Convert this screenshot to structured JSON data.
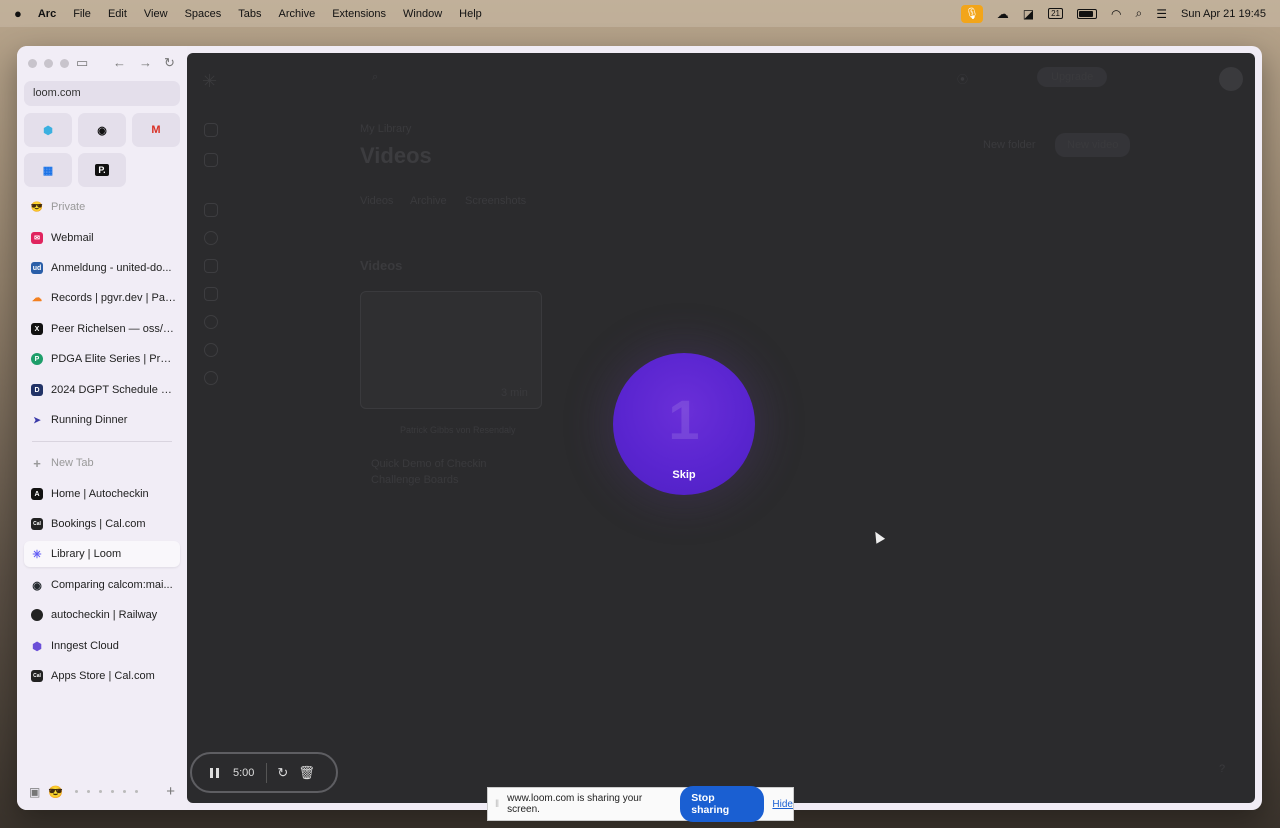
{
  "menubar": {
    "app": "Arc",
    "items": [
      "File",
      "Edit",
      "View",
      "Spaces",
      "Tabs",
      "Archive",
      "Extensions",
      "Window",
      "Help"
    ],
    "clock": "Sun Apr 21  19:45",
    "calendar_day": "21"
  },
  "sidebar": {
    "url": "loom.com",
    "pinned": [
      {
        "icon": "app-icon",
        "color": "#3bb0e0"
      },
      {
        "icon": "github-icon",
        "color": "#111111"
      },
      {
        "icon": "gmail-icon",
        "color": "#d93025"
      },
      {
        "icon": "calendar-icon",
        "color": "#1a73e8"
      },
      {
        "icon": "app-p-icon",
        "color": "#111111"
      }
    ],
    "tabs": [
      {
        "label": "Private",
        "icon_char": "😎",
        "color": "#f4c542",
        "muted": true
      },
      {
        "label": "Webmail",
        "icon_char": "✉",
        "color": "#e0245e"
      },
      {
        "label": "Anmeldung - united-do...",
        "icon_char": "ud",
        "color": "#2a5ea8"
      },
      {
        "label": "Records | pgvr.dev | Pat...",
        "icon_char": "☁",
        "color": "#f38020"
      },
      {
        "label": "Peer Richelsen — oss/a...",
        "icon_char": "X",
        "color": "#111111"
      },
      {
        "label": "PDGA Elite Series | Prof...",
        "icon_char": "P",
        "color": "#1e9e6a"
      },
      {
        "label": "2024 DGPT Schedule S...",
        "icon_char": "D",
        "color": "#223366"
      },
      {
        "label": "Running Dinner",
        "icon_char": "R",
        "color": "#3a3aa8"
      }
    ],
    "new_tab": "New Tab",
    "tabs2": [
      {
        "label": "Home | Autocheckin",
        "icon_char": "A",
        "color": "#111111"
      },
      {
        "label": "Bookings | Cal.com",
        "icon_char": "Cal",
        "color": "#222222"
      },
      {
        "label": "Library | Loom",
        "icon_char": "✳",
        "color": "#625df5",
        "active": true
      },
      {
        "label": "Comparing calcom:mai...",
        "icon_char": "◉",
        "color": "#24292e"
      },
      {
        "label": "autocheckin | Railway",
        "icon_char": "●",
        "color": "#222222"
      },
      {
        "label": "Inngest Cloud",
        "icon_char": "⬢",
        "color": "#6b4fd8"
      },
      {
        "label": "Apps Store | Cal.com",
        "icon_char": "Cal",
        "color": "#222222"
      }
    ]
  },
  "loom": {
    "breadcrumb": "My Library",
    "title": "Videos",
    "tabs": [
      "Videos",
      "Archive",
      "Screenshots"
    ],
    "section": "Videos",
    "new_folder": "New folder",
    "new_video": "New video",
    "upgrade": "Upgrade",
    "video_author": "Patrick Gibbs von Resendaly",
    "video_title": "Quick Demo of Checkin Challenge Boards",
    "video_duration": "3 min",
    "countdown": "1",
    "skip": "Skip"
  },
  "recorder": {
    "time": "5:00"
  },
  "sharing": {
    "message": "www.loom.com is sharing your screen.",
    "stop": "Stop sharing",
    "hide": "Hide"
  },
  "colors": {
    "accent": "#1a5fd2",
    "loom_purple": "#5a25d0",
    "overlay": "#2b2b2d"
  }
}
